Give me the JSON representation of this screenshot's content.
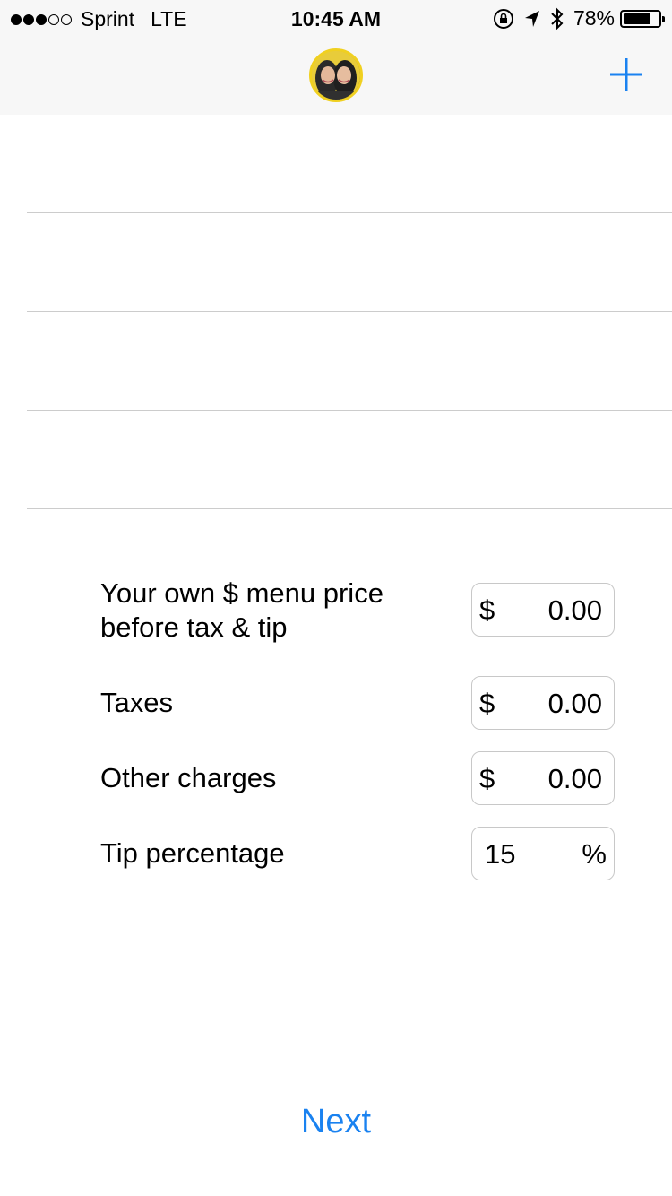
{
  "status_bar": {
    "carrier": "Sprint",
    "network": "LTE",
    "time": "10:45 AM",
    "battery_percent": "78%",
    "battery_level": 0.78,
    "signal_bars_filled": 3,
    "signal_bars_total": 5
  },
  "nav": {
    "avatar_alt": "profile photo",
    "add_icon": "plus-icon",
    "accent_color": "#1a82f0"
  },
  "form": {
    "menu_price": {
      "label": "Your own $ menu price before tax & tip",
      "prefix": "$",
      "value": "0.00"
    },
    "taxes": {
      "label": "Taxes",
      "prefix": "$",
      "value": "0.00"
    },
    "other_charges": {
      "label": "Other charges",
      "prefix": "$",
      "value": "0.00"
    },
    "tip_percentage": {
      "label": "Tip percentage",
      "value": "15",
      "suffix": "%"
    }
  },
  "next_label": "Next"
}
